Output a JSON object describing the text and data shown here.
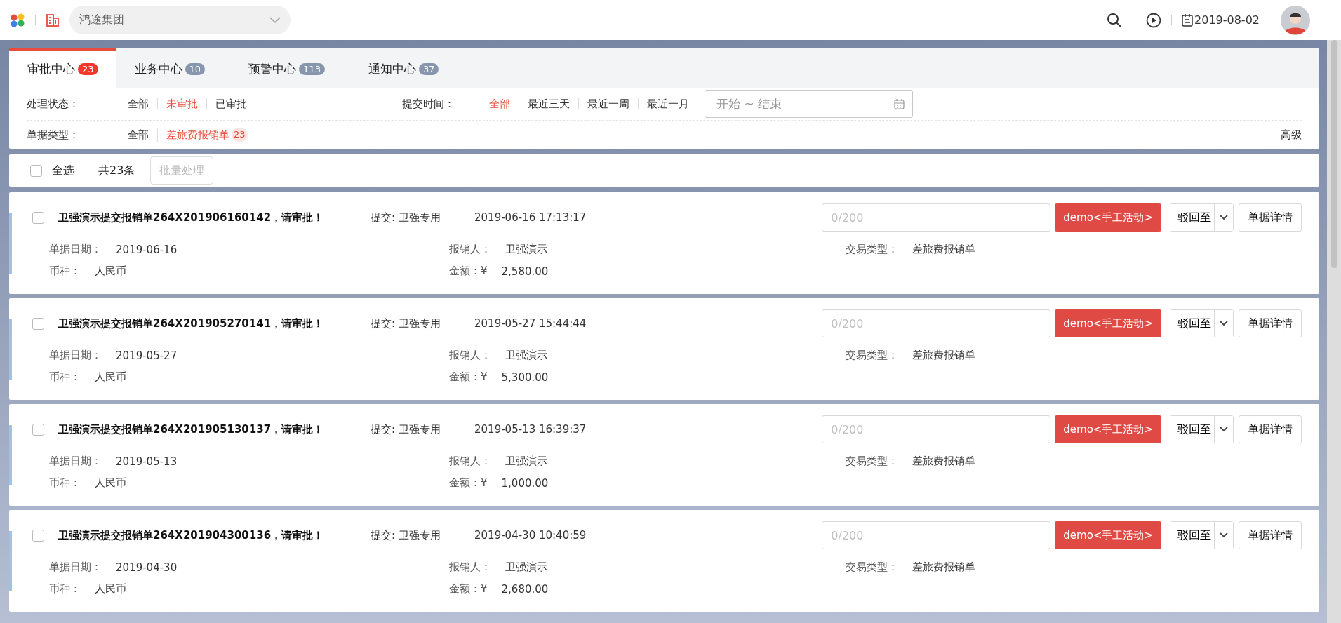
{
  "header": {
    "org": "鸿途集团",
    "date": "2019-08-02"
  },
  "tabs": [
    {
      "label": "审批中心",
      "count": "23",
      "selected": true
    },
    {
      "label": "业务中心",
      "count": "10",
      "selected": false
    },
    {
      "label": "预警中心",
      "count": "113",
      "selected": false
    },
    {
      "label": "通知中心",
      "count": "37",
      "selected": false
    }
  ],
  "filters": [
    {
      "label": "处理状态：",
      "options": [
        {
          "label": "全部",
          "selected": false
        },
        {
          "label": "未审批",
          "selected": true
        },
        {
          "label": "已审批",
          "selected": false
        }
      ]
    },
    {
      "label": "提交时间：",
      "options": [
        {
          "label": "全部",
          "selected": true
        },
        {
          "label": "最近三天",
          "selected": false
        },
        {
          "label": "最近一周",
          "selected": false
        },
        {
          "label": "最近一月",
          "selected": false
        }
      ],
      "date_range": {
        "placeholder": "开始 ~ 结束"
      }
    },
    {
      "label": "单据类型：",
      "options": [
        {
          "label": "全部",
          "selected": false
        },
        {
          "label": "差旅费报销单",
          "count": "23",
          "selected": true
        }
      ],
      "advanced": "高级"
    }
  ],
  "toolbar": {
    "select_all": {
      "label": "全选",
      "checked": false
    },
    "total": "共23条",
    "batch": {
      "label": "批量处理",
      "disabled": true
    }
  },
  "cards": [
    {
      "checked": false,
      "title": "卫强演示提交报销单264X201906160142，请审批！",
      "submitter": "提交: 卫强专用",
      "time": "2019-06-16 17:13:17",
      "comment": {
        "placeholder": "0/200"
      },
      "action": "demo<手工活动>",
      "reject": "驳回至",
      "details": "单据详情",
      "fields": [
        {
          "label": "单据日期：",
          "value": "2019-06-16"
        },
        {
          "label": "报销人：",
          "value": "卫强演示"
        },
        {
          "label": "交易类型：",
          "value": "差旅费报销单"
        },
        {
          "label": "币种：",
          "value": "人民币"
        },
        {
          "label": "金额：¥",
          "value": "2,580.00"
        }
      ]
    },
    {
      "checked": false,
      "title": "卫强演示提交报销单264X201905270141，请审批！",
      "submitter": "提交: 卫强专用",
      "time": "2019-05-27 15:44:44",
      "comment": {
        "placeholder": "0/200"
      },
      "action": "demo<手工活动>",
      "reject": "驳回至",
      "details": "单据详情",
      "fields": [
        {
          "label": "单据日期：",
          "value": "2019-05-27"
        },
        {
          "label": "报销人：",
          "value": "卫强演示"
        },
        {
          "label": "交易类型：",
          "value": "差旅费报销单"
        },
        {
          "label": "币种：",
          "value": "人民币"
        },
        {
          "label": "金额：¥",
          "value": "5,300.00"
        }
      ]
    },
    {
      "checked": false,
      "title": "卫强演示提交报销单264X201905130137，请审批！",
      "submitter": "提交: 卫强专用",
      "time": "2019-05-13 16:39:37",
      "comment": {
        "placeholder": "0/200"
      },
      "action": "demo<手工活动>",
      "reject": "驳回至",
      "details": "单据详情",
      "fields": [
        {
          "label": "单据日期：",
          "value": "2019-05-13"
        },
        {
          "label": "报销人：",
          "value": "卫强演示"
        },
        {
          "label": "交易类型：",
          "value": "差旅费报销单"
        },
        {
          "label": "币种：",
          "value": "人民币"
        },
        {
          "label": "金额：¥",
          "value": "1,000.00"
        }
      ]
    },
    {
      "checked": false,
      "title": "卫强演示提交报销单264X201904300136，请审批！",
      "submitter": "提交: 卫强专用",
      "time": "2019-04-30 10:40:59",
      "comment": {
        "placeholder": "0/200"
      },
      "action": "demo<手工活动>",
      "reject": "驳回至",
      "details": "单据详情",
      "fields": [
        {
          "label": "单据日期：",
          "value": "2019-04-30"
        },
        {
          "label": "报销人：",
          "value": "卫强演示"
        },
        {
          "label": "交易类型：",
          "value": "差旅费报销单"
        },
        {
          "label": "币种：",
          "value": "人民币"
        },
        {
          "label": "金额：¥",
          "value": "2,680.00"
        }
      ]
    }
  ]
}
